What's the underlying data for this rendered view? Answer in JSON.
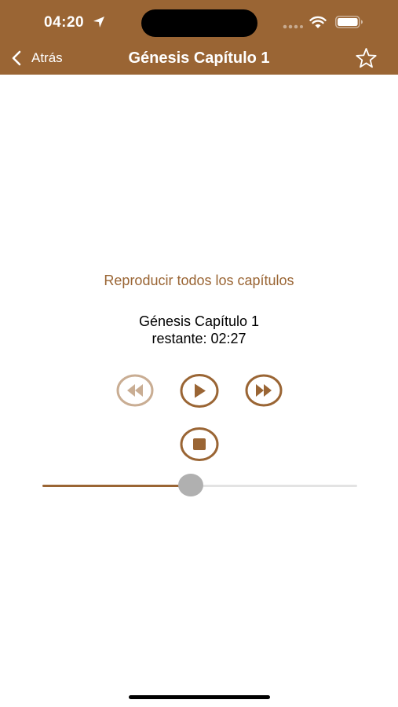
{
  "status_bar": {
    "time": "04:20"
  },
  "nav": {
    "back_label": "Atrás",
    "title": "Génesis Capítulo 1"
  },
  "player": {
    "play_all_label": "Reproducir todos los capítulos",
    "track_title": "Génesis Capítulo 1",
    "remaining": "restante: 02:27",
    "progress_fraction": 0.47
  },
  "colors": {
    "brand": "#9A6534",
    "disabled": "#C9AD93",
    "track_unfilled": "#E3E3E3",
    "thumb": "#B0B0B0"
  },
  "icons": [
    "location-arrow-icon",
    "wifi-icon",
    "battery-icon",
    "chevron-left-icon",
    "star-outline-icon",
    "rewind-icon",
    "play-icon",
    "fast-forward-icon",
    "stop-icon"
  ]
}
